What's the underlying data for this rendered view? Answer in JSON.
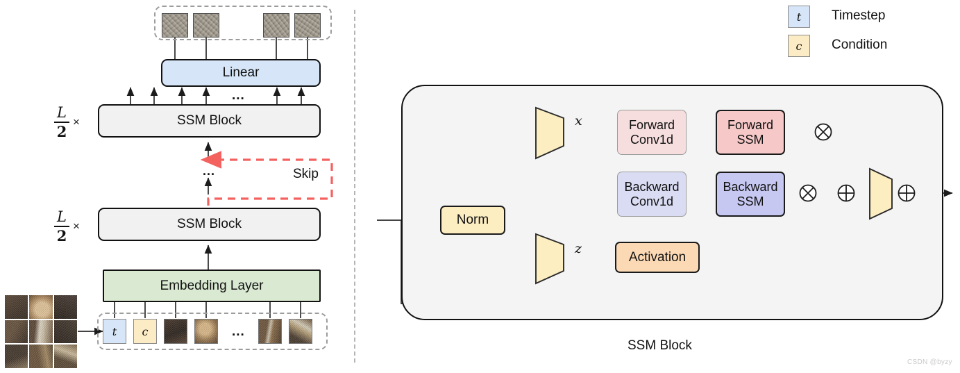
{
  "figure": {
    "caption_right": "SSM Block",
    "watermark": "CSDN @byzy"
  },
  "legend": {
    "items": [
      {
        "symbol": "t",
        "label": "Timestep",
        "color": "#d6e5f7"
      },
      {
        "symbol": "c",
        "label": "Condition",
        "color": "#fcecc6"
      }
    ]
  },
  "left_pipeline": {
    "repeat_label_top": {
      "numerator": "L",
      "denominator": "2",
      "times": "×"
    },
    "repeat_label_bottom": {
      "numerator": "L",
      "denominator": "2",
      "times": "×"
    },
    "blocks": [
      {
        "name": "linear",
        "label": "Linear",
        "fill": "#d6e5f7"
      },
      {
        "name": "ssm-block-top",
        "label": "SSM Block",
        "fill": "#f1f1f1"
      },
      {
        "name": "ssm-block-bottom",
        "label": "SSM Block",
        "fill": "#f1f1f1"
      },
      {
        "name": "embedding-layer",
        "label": "Embedding Layer",
        "fill": "#d9e9d2"
      }
    ],
    "skip_label": "Skip",
    "skip_color": "#f4625f",
    "ellipsis": "...",
    "tokens": [
      {
        "type": "timestep",
        "symbol": "t",
        "fill": "#d6e5f7"
      },
      {
        "type": "condition",
        "symbol": "c",
        "fill": "#fcecc6"
      },
      {
        "type": "patch",
        "symbol": "",
        "fill": "#3a3028"
      },
      {
        "type": "patch",
        "symbol": "",
        "fill": "#a3875f"
      },
      {
        "type": "ellipsis",
        "symbol": "...",
        "fill": ""
      },
      {
        "type": "patch",
        "symbol": "",
        "fill": "#8a6b4c"
      },
      {
        "type": "patch",
        "symbol": "",
        "fill": "#9a8158"
      }
    ]
  },
  "ssm_block": {
    "title": "SSM Block",
    "nodes": [
      {
        "name": "norm",
        "label": "Norm",
        "fill": "#fdeec2",
        "border": "strong"
      },
      {
        "name": "forward-conv1d",
        "label": "Forward\nConv1d",
        "fill": "#f7dede",
        "border": "soft"
      },
      {
        "name": "backward-conv1d",
        "label": "Backward\nConv1d",
        "fill": "#dadcf3",
        "border": "soft"
      },
      {
        "name": "forward-ssm",
        "label": "Forward\nSSM",
        "fill": "#f6c8c8",
        "border": "strong"
      },
      {
        "name": "backward-ssm",
        "label": "Backward\nSSM",
        "fill": "#c6c8f2",
        "border": "strong"
      },
      {
        "name": "activation",
        "label": "Activation",
        "fill": "#fbd9b5",
        "border": "strong"
      }
    ],
    "projections": [
      {
        "name": "proj-x",
        "fill": "#fdeec2"
      },
      {
        "name": "proj-z",
        "fill": "#fdeec2"
      },
      {
        "name": "proj-out",
        "fill": "#fdeec2"
      }
    ],
    "signal_labels": [
      {
        "name": "signal-x",
        "text": "x"
      },
      {
        "name": "signal-z",
        "text": "z"
      }
    ],
    "operators": [
      {
        "name": "multiply-forward",
        "glyph": "⊗"
      },
      {
        "name": "multiply-backward",
        "glyph": "⊗"
      },
      {
        "name": "add-merge",
        "glyph": "⊕"
      },
      {
        "name": "add-residual",
        "glyph": "⊕"
      }
    ]
  }
}
